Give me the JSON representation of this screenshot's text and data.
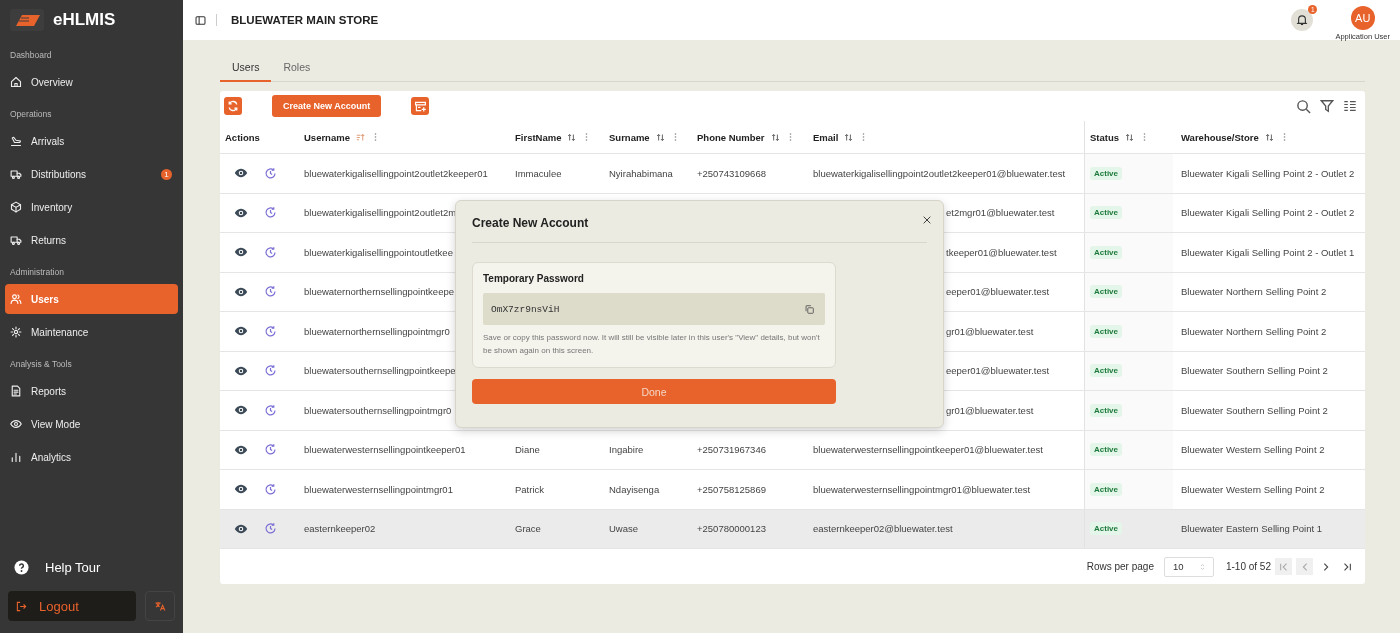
{
  "app": {
    "name": "eHLMIS"
  },
  "sidebar": {
    "sections": [
      {
        "title": "Dashboard",
        "items": [
          {
            "label": "Overview",
            "selected": false
          }
        ]
      },
      {
        "title": "Operations",
        "items": [
          {
            "label": "Arrivals",
            "selected": false
          },
          {
            "label": "Distributions",
            "selected": false,
            "badge": "1"
          },
          {
            "label": "Inventory",
            "selected": false
          },
          {
            "label": "Returns",
            "selected": false
          }
        ]
      },
      {
        "title": "Administration",
        "items": [
          {
            "label": "Users",
            "selected": true
          },
          {
            "label": "Maintenance",
            "selected": false
          }
        ]
      },
      {
        "title": "Analysis & Tools",
        "items": [
          {
            "label": "Reports",
            "selected": false
          },
          {
            "label": "View Mode",
            "selected": false
          },
          {
            "label": "Analytics",
            "selected": false
          }
        ]
      }
    ],
    "help": "Help Tour",
    "logout": "Logout"
  },
  "topbar": {
    "store": "BLUEWATER MAIN STORE",
    "notification_count": "1",
    "avatar": "AU",
    "user": "Application User"
  },
  "tabs": [
    {
      "label": "Users",
      "selected": true
    },
    {
      "label": "Roles",
      "selected": false
    }
  ],
  "toolbar": {
    "create_button": "Create New Account"
  },
  "table": {
    "columns": [
      {
        "label": "Actions",
        "kind": "plain"
      },
      {
        "label": "Username",
        "kind": "sortable",
        "sorted": true
      },
      {
        "label": "FirstName",
        "kind": "sortable",
        "sorted": false
      },
      {
        "label": "Surname",
        "kind": "sortable",
        "sorted": false
      },
      {
        "label": "Phone Number",
        "kind": "sortable",
        "sorted": false
      },
      {
        "label": "Email",
        "kind": "sortable",
        "sorted": false
      },
      {
        "label": "Status",
        "kind": "sortable",
        "sorted": false
      },
      {
        "label": "Warehouse/Store",
        "kind": "sortable",
        "sorted": false
      }
    ],
    "rows": [
      {
        "kind": "full",
        "highlighted": false,
        "username": "bluewaterkigalisellingpoint2outlet2keeper01",
        "firstname": "Immaculee",
        "surname": "Nyirahabimana",
        "phone": "+250743109668",
        "email": "bluewaterkigalisellingpoint2outlet2keeper01@bluewater.test",
        "status": "Active",
        "store": "Bluewater Kigali Selling Point 2 - Outlet 2"
      },
      {
        "kind": "behind_dialog",
        "highlighted": false,
        "username": "bluewaterkigalisellingpoint2outlet2m",
        "email": "et2mgr01@bluewater.test",
        "status": "Active",
        "store": "Bluewater Kigali Selling Point 2 - Outlet 2"
      },
      {
        "kind": "behind_dialog",
        "highlighted": false,
        "username": "bluewaterkigalisellingpointoutletkee",
        "email": "tkeeper01@bluewater.test",
        "status": "Active",
        "store": "Bluewater Kigali Selling Point 2 - Outlet 1"
      },
      {
        "kind": "behind_dialog",
        "highlighted": false,
        "username": "bluewaternorthernsellingpointkeepe",
        "email": "eeper01@bluewater.test",
        "status": "Active",
        "store": "Bluewater Northern Selling Point 2"
      },
      {
        "kind": "behind_dialog",
        "highlighted": false,
        "username": "bluewaternorthernsellingpointmgr0",
        "email": "gr01@bluewater.test",
        "status": "Active",
        "store": "Bluewater Northern Selling Point 2"
      },
      {
        "kind": "behind_dialog",
        "highlighted": false,
        "username": "bluewatersouthernsellingpointkeepe",
        "email": "eeper01@bluewater.test",
        "status": "Active",
        "store": "Bluewater Southern Selling Point 2"
      },
      {
        "kind": "behind_dialog",
        "highlighted": false,
        "username": "bluewatersouthernsellingpointmgr0",
        "email": "gr01@bluewater.test",
        "status": "Active",
        "store": "Bluewater Southern Selling Point 2"
      },
      {
        "kind": "full",
        "highlighted": false,
        "username": "bluewaterwesternsellingpointkeeper01",
        "firstname": "Diane",
        "surname": "Ingabire",
        "phone": "+250731967346",
        "email": "bluewaterwesternsellingpointkeeper01@bluewater.test",
        "status": "Active",
        "store": "Bluewater Western Selling Point 2"
      },
      {
        "kind": "full",
        "highlighted": false,
        "username": "bluewaterwesternsellingpointmgr01",
        "firstname": "Patrick",
        "surname": "Ndayisenga",
        "phone": "+250758125869",
        "email": "bluewaterwesternsellingpointmgr01@bluewater.test",
        "status": "Active",
        "store": "Bluewater Western Selling Point 2"
      },
      {
        "kind": "full",
        "highlighted": true,
        "username": "easternkeeper02",
        "firstname": "Grace",
        "surname": "Uwase",
        "phone": "+250780000123",
        "email": "easternkeeper02@bluewater.test",
        "status": "Active",
        "store": "Bluewater Eastern Selling Point 1"
      }
    ]
  },
  "pagination": {
    "label": "Rows per page",
    "page_size": "10",
    "range": "1-10 of 52",
    "first_disabled": true,
    "prev_disabled": true
  },
  "dialog": {
    "title": "Create New Account",
    "section_title": "Temporary Password",
    "password": "OmX7zr9nsViH",
    "note": "Save or copy this password now. It will still be visible later in this user's \"View\" details, but won't be shown again on this screen.",
    "button": "Done"
  }
}
